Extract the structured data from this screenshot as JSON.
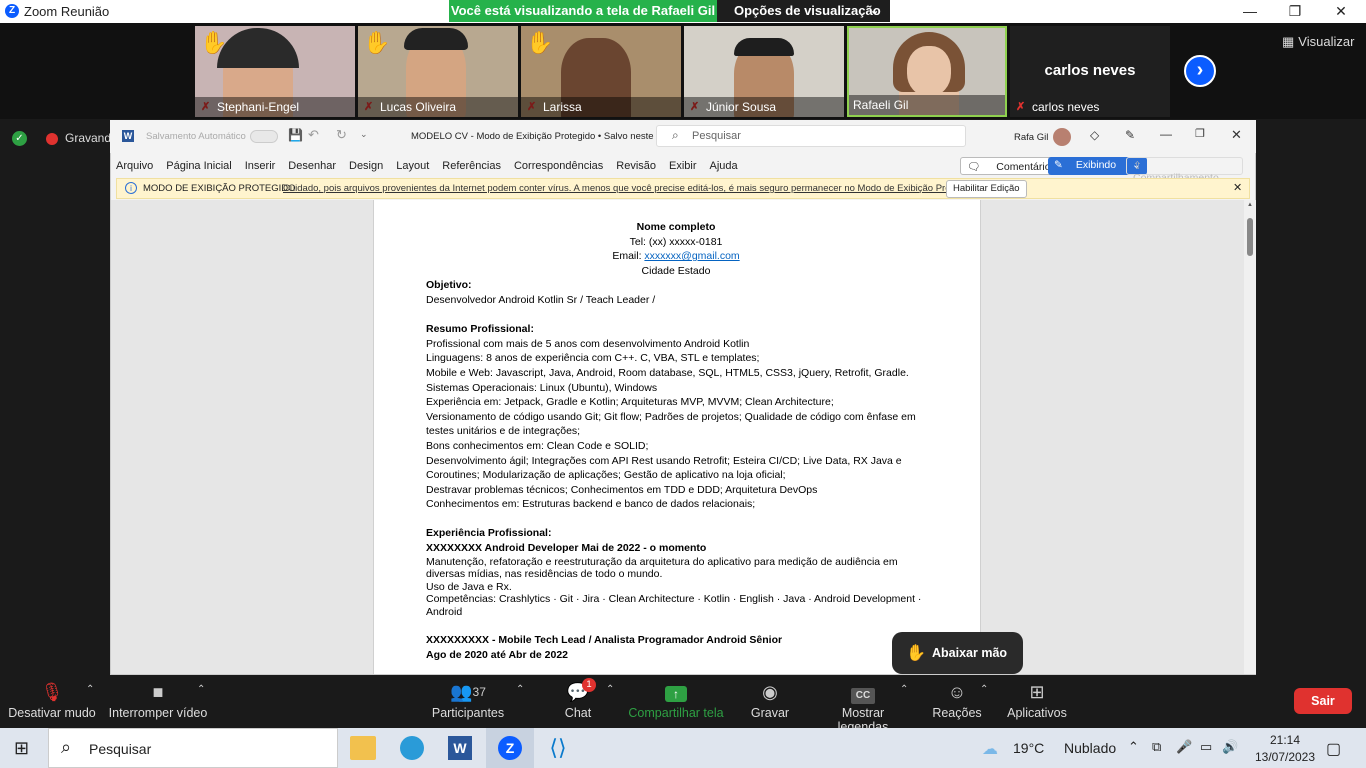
{
  "window": {
    "title": "Zoom Reunião",
    "minimize": "—",
    "restore": "❐",
    "close": "✕"
  },
  "banner": {
    "text": "Você está visualizando a tela de Rafaeli Gil",
    "options": "Opções de visualização"
  },
  "participants": [
    {
      "name": "Stephani-Engel",
      "hand": true,
      "bg": "#c8b4b4",
      "skin": "#d9a98a"
    },
    {
      "name": "Lucas Oliveira",
      "hand": true,
      "bg": "#b8a890",
      "skin": "#d4a582"
    },
    {
      "name": "Larissa",
      "hand": true,
      "bg": "#a98e6c",
      "skin": "#6a4530"
    },
    {
      "name": "Júnior Sousa",
      "hand": false,
      "bg": "#d4d0c8",
      "skin": "#b88a68"
    },
    {
      "name": "Rafaeli Gil",
      "hand": false,
      "bg": "#c8c4bc",
      "skin": "#e8c4a8",
      "active": true
    },
    {
      "name": "carlos neves",
      "hand": false,
      "center_name": "carlos neves"
    }
  ],
  "gallery": {
    "visualizar": "Visualizar"
  },
  "recording": {
    "label": "Gravando"
  },
  "word": {
    "autosave": "Salvamento Automático",
    "doc_title": "MODELO CV  -  Modo de Exibição Protegido • Salvo neste PC ⌄",
    "search": "Pesquisar",
    "user": "Rafa Gil",
    "tabs": [
      "Arquivo",
      "Página Inicial",
      "Inserir",
      "Desenhar",
      "Design",
      "Layout",
      "Referências",
      "Correspondências",
      "Revisão",
      "Exibir",
      "Ajuda"
    ],
    "comentarios": "Comentários",
    "exibindo": "Exibindo",
    "compartilhamento": "Compartilhamento",
    "protected_label": "MODO DE EXIBIÇÃO PROTEGIDO",
    "protected_msg": "Cuidado, pois arquivos provenientes da Internet podem conter vírus. A menos que você precise editá-los, é mais seguro permanecer no Modo de  Exibição Protegido.",
    "enable_edit": "Habilitar Edição"
  },
  "doc": {
    "name": "Nome completo",
    "tel": "Tel: (xx) xxxxx-0181",
    "email_label": "Email: ",
    "email": "xxxxxxx@gmail.com",
    "city": "Cidade Estado",
    "obj_h": "Objetivo:",
    "obj": "Desenvolvedor Android Kotlin Sr / Teach Leader /",
    "resumo_h": "Resumo Profissional:",
    "resumo": [
      "Profissional com mais de 5 anos com desenvolvimento Android Kotlin",
      "Linguagens: 8 anos de experiência com C++. C, VBA, STL e templates;",
      "Mobile e Web: Javascript, Java, Android, Room database, SQL, HTML5, CSS3, jQuery, Retrofit, Gradle.",
      "Sistemas Operacionais: Linux (Ubuntu), Windows",
      "Experiência em: Jetpack, Gradle e Kotlin; Arquiteturas MVP, MVVM; Clean Architecture;",
      "Versionamento de código usando Git; Git flow; Padrões de projetos; Qualidade de código com ênfase em testes unitários e de integrações;",
      "Bons conhecimentos em: Clean Code e SOLID;",
      "Desenvolvimento ágil; Integrações com API Rest usando Retrofit; Esteira CI/CD; Live Data, RX Java e Coroutines; Modularização de aplicações; Gestão de aplicativo na loja oficial;",
      "Destravar problemas técnicos; Conhecimentos em TDD e DDD; Arquitetura DevOps",
      "Conhecimentos em: Estruturas backend e banco de dados relacionais;"
    ],
    "exp_h": "Experiência Profissional:",
    "job1": "XXXXXXXX Android Developer Mai de 2022 - o momento",
    "job1_lines": [
      "Manutenção, refatoração e reestruturação da arquitetura do aplicativo para medição de audiência em diversas mídias, nas residências de todo o mundo.",
      "Uso de Java e Rx.",
      "Competências: Crashlytics · Git · Jira · Clean Architecture · Kotlin · English · Java · Android Development · Android"
    ],
    "job2": "XXXXXXXXX - Mobile Tech Lead / Analista Programador Android Sênior",
    "job2_date": "Ago de 2020 até Abr de 2022"
  },
  "raise_hand": "Abaixar mão",
  "toolbar": {
    "mute": "Desativar mudo",
    "video": "Interromper vídeo",
    "participants": "Participantes",
    "participants_count": "37",
    "chat": "Chat",
    "chat_badge": "1",
    "share": "Compartilhar tela",
    "record": "Gravar",
    "captions": "Mostrar legendas",
    "reactions": "Reações",
    "apps": "Aplicativos",
    "leave": "Sair"
  },
  "taskbar": {
    "search": "Pesquisar",
    "weather_temp": "19°C",
    "weather_desc": "Nublado",
    "time": "21:14",
    "date": "13/07/2023"
  }
}
